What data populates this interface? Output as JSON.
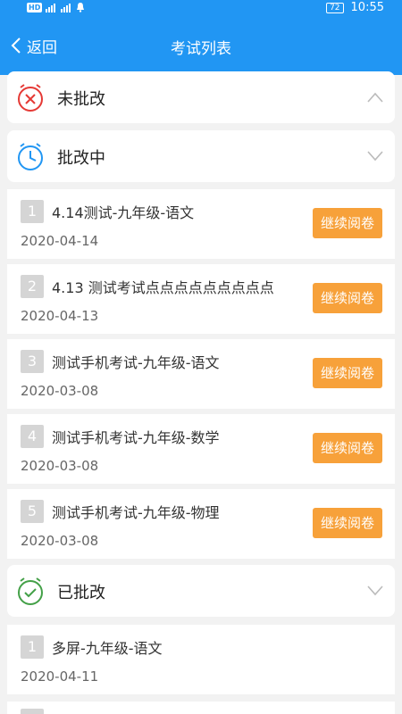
{
  "status": {
    "hd": "HD",
    "battery": "72",
    "time": "10:55"
  },
  "nav": {
    "back_label": "返回",
    "title": "考试列表"
  },
  "sections": {
    "unmarked": {
      "label": "未批改"
    },
    "marking": {
      "label": "批改中"
    },
    "marked": {
      "label": "已批改"
    }
  },
  "marking_items": [
    {
      "num": "1",
      "title": "4.14测试-九年级-语文",
      "date": "2020-04-14",
      "action": "继续阅卷"
    },
    {
      "num": "2",
      "title": "4.13 测试考试点点点点点点点点点",
      "date": "2020-04-13",
      "action": "继续阅卷"
    },
    {
      "num": "3",
      "title": "测试手机考试-九年级-语文",
      "date": "2020-03-08",
      "action": "继续阅卷"
    },
    {
      "num": "4",
      "title": "测试手机考试-九年级-数学",
      "date": "2020-03-08",
      "action": "继续阅卷"
    },
    {
      "num": "5",
      "title": "测试手机考试-九年级-物理",
      "date": "2020-03-08",
      "action": "继续阅卷"
    }
  ],
  "marked_items": [
    {
      "num": "1",
      "title": "多屏-九年级-语文",
      "date": "2020-04-11"
    }
  ],
  "colors": {
    "primary": "#2196f3",
    "action": "#f7a13a",
    "unmarked": "#e53935",
    "marking": "#2196f3",
    "marked": "#43a047"
  }
}
